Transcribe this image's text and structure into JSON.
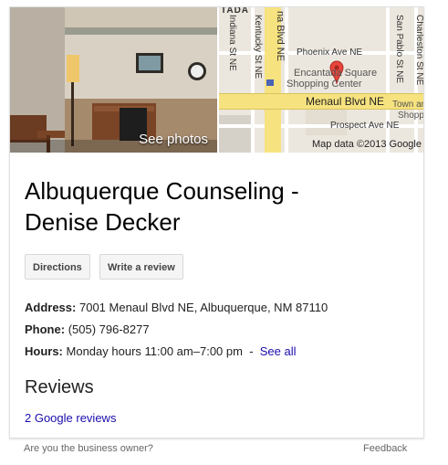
{
  "hero": {
    "photo_label": "See photos",
    "map": {
      "streets": {
        "phoenix": "Phoenix Ave NE",
        "menaul": "Menaul Blvd NE",
        "prospect": "Prospect Ave NE",
        "indiana": "Indiana St NE",
        "kentucky": "Kentucky St NE",
        "blvd": "na Blvd NE",
        "san_pablo": "San Pablo St NE",
        "charleston": "Charleston St NE"
      },
      "places": {
        "encantada_1": "Encantada Square",
        "encantada_2": "Shopping Center",
        "town_1": "Town and",
        "town_2": "Shoppin"
      },
      "top_edge": "TADA",
      "attribution": "Map data ©2013 Google"
    }
  },
  "business": {
    "name_line1": "Albuquerque Counseling -",
    "name_line2": "Denise Decker"
  },
  "actions": {
    "directions": "Directions",
    "review": "Write a review"
  },
  "details": {
    "address_label": "Address:",
    "address_value": "7001 Menaul Blvd NE, Albuquerque, NM 87110",
    "phone_label": "Phone:",
    "phone_value": "(505) 796-8277",
    "hours_label": "Hours:",
    "hours_value": "Monday hours 11:00 am–7:00 pm",
    "hours_sep": "-",
    "hours_link": "See all"
  },
  "reviews": {
    "heading": "Reviews",
    "link": "2 Google reviews"
  },
  "footer": {
    "owner": "Are you the business owner?",
    "feedback": "Feedback"
  },
  "colors": {
    "link": "#1a0dab",
    "road_major": "#f6e27f",
    "pin": "#e8453c"
  }
}
